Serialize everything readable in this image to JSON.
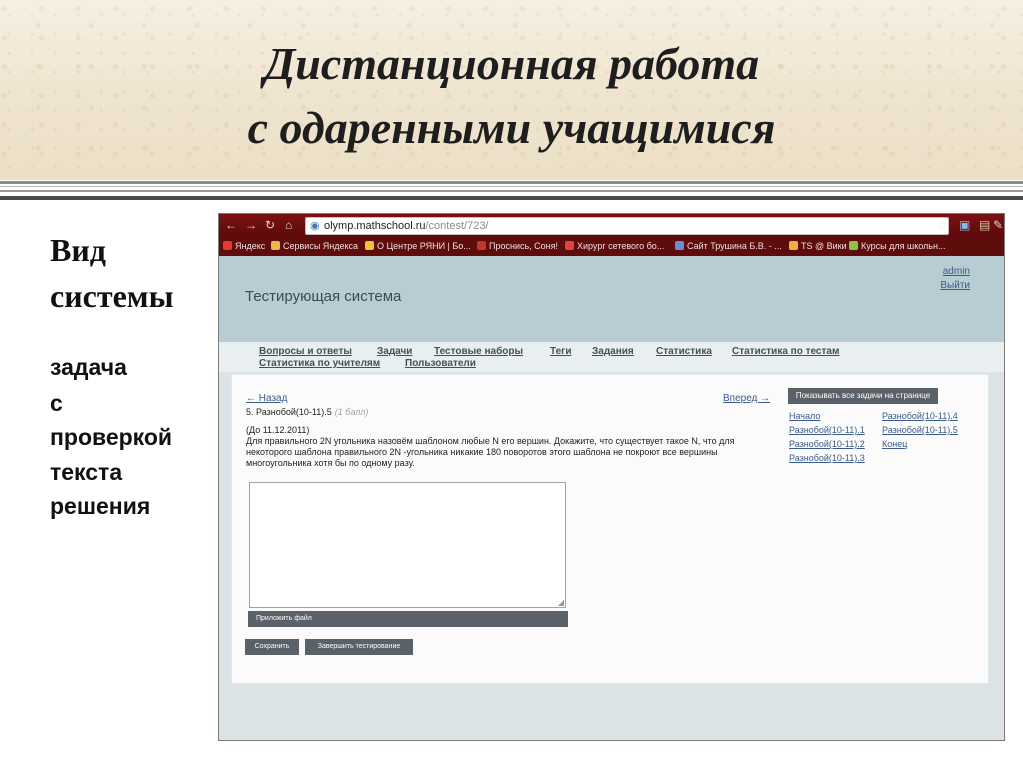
{
  "slide": {
    "title_line1": "Дистанционная работа",
    "title_line2": "с одаренными учащимися",
    "caption_line1": "Вид",
    "caption_line2": "системы",
    "sub_lines": [
      "задача",
      "с",
      "проверкой",
      "текста",
      "решения"
    ]
  },
  "browser": {
    "url_host": "olymp.mathschool.ru",
    "url_path": "/contest/723/",
    "bookmarks": [
      {
        "label": "Яндекс",
        "icon": "yandex-icon",
        "color": "#e03c2f"
      },
      {
        "label": "Сервисы Яндекса",
        "icon": "folder-icon",
        "color": "#e8b84a"
      },
      {
        "label": "О Центре РЯНИ | Бо...",
        "icon": "page-icon",
        "color": "#e8c43a"
      },
      {
        "label": "Проснись, Соня!",
        "icon": "page-icon",
        "color": "#c0392b"
      },
      {
        "label": "Хирург сетевого бо...",
        "icon": "page-icon",
        "color": "#d44"
      },
      {
        "label": "Сайт Трушина Б.В. - ...",
        "icon": "page-icon",
        "color": "#6a8ed6"
      },
      {
        "label": "TS @ Вики",
        "icon": "wiki-icon",
        "color": "#e8b43a"
      },
      {
        "label": "Курсы для школьн...",
        "icon": "page-icon",
        "color": "#8bc34a"
      }
    ]
  },
  "site": {
    "title": "Тестирующая система",
    "user_name": "admin",
    "logout": "Выйти",
    "nav": [
      "Вопросы и ответы",
      "Задачи",
      "Тестовые наборы",
      "Теги",
      "Задания",
      "Статистика",
      "Статистика по тестам",
      "Статистика по учителям",
      "Пользователи"
    ]
  },
  "task": {
    "back": "← Назад",
    "forward": "Вперед →",
    "title": "5. Разнобой(10-11).5",
    "points": "(1 балл)",
    "due": "(До 11.12.2011)",
    "body": "Для правильного 2N угольника назовём шаблоном любые N его вершин. Докажите, что существует такое N, что для некоторого шаблона правильного 2N -угольника никакие 180 поворотов этого шаблона не покроют все вершины многоугольника хотя бы по одному разу.",
    "show_all": "Показывать все задачи на странице",
    "links_col1": [
      "Начало",
      "Разнобой(10-11).1",
      "Разнобой(10-11).2",
      "Разнобой(10-11).3"
    ],
    "links_col2": [
      "Разнобой(10-11).4",
      "Разнобой(10-11).5",
      "Конец"
    ],
    "attach": "Приложить файл",
    "save": "Сохранить",
    "finish": "Завершить тестирование"
  }
}
